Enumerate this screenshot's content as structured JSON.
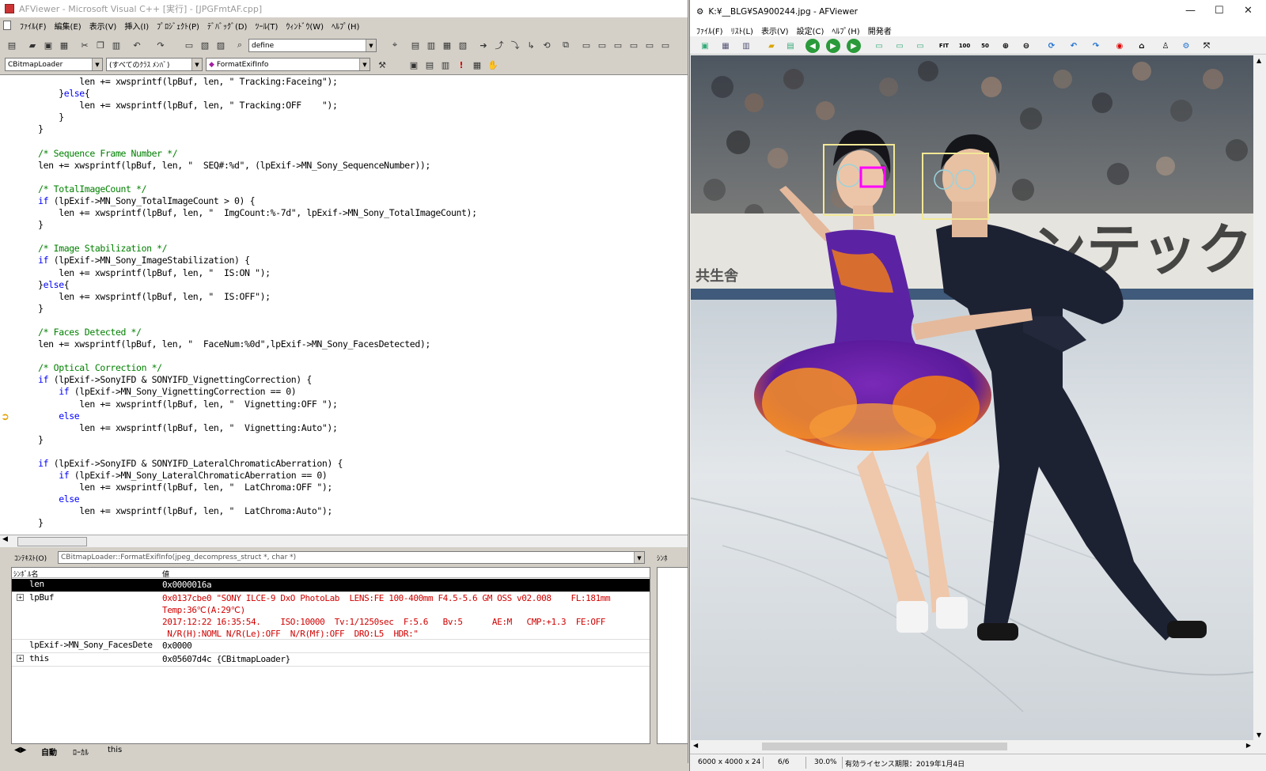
{
  "vs": {
    "title": "AFViewer - Microsoft Visual C++ [実行] - [JPGFmtAF.cpp]",
    "menu": [
      "ﾌｧｲﾙ(F)",
      "編集(E)",
      "表示(V)",
      "挿入(I)",
      "ﾌﾟﾛｼﾞｪｸﾄ(P)",
      "ﾃﾞﾊﾞｯｸﾞ(D)",
      "ﾂｰﾙ(T)",
      "ｳｨﾝﾄﾞｳ(W)",
      "ﾍﾙﾌﾟ(H)"
    ],
    "find_combo": "define",
    "class_combo": "CBitmapLoader",
    "member_combo": "(すべてのｸﾗｽ ﾒﾝﾊﾞ)",
    "function_combo": "FormatExifInfo",
    "code_lines": [
      "            len += xwsprintf(lpBuf, len, \" Tracking:Faceing\");",
      "        }else{",
      "            len += xwsprintf(lpBuf, len, \" Tracking:OFF    \");",
      "        }",
      "    }",
      "",
      "    /* Sequence Frame Number */",
      "    len += xwsprintf(lpBuf, len, \"  SEQ#:%d\", (lpExif->MN_Sony_SequenceNumber));",
      "",
      "    /* TotalImageCount */",
      "    if (lpExif->MN_Sony_TotalImageCount > 0) {",
      "        len += xwsprintf(lpBuf, len, \"  ImgCount:%-7d\", lpExif->MN_Sony_TotalImageCount);",
      "    }",
      "",
      "    /* Image Stabilization */",
      "    if (lpExif->MN_Sony_ImageStabilization) {",
      "        len += xwsprintf(lpBuf, len, \"  IS:ON \");",
      "    }else{",
      "        len += xwsprintf(lpBuf, len, \"  IS:OFF\");",
      "    }",
      "",
      "    /* Faces Detected */",
      "    len += xwsprintf(lpBuf, len, \"  FaceNum:%0d\",lpExif->MN_Sony_FacesDetected);",
      "",
      "    /* Optical Correction */",
      "    if (lpExif->SonyIFD & SONYIFD_VignettingCorrection) {",
      "        if (lpExif->MN_Sony_VignettingCorrection == 0)",
      "            len += xwsprintf(lpBuf, len, \"  Vignetting:OFF \");",
      "        else",
      "            len += xwsprintf(lpBuf, len, \"  Vignetting:Auto\");",
      "    }",
      "",
      "    if (lpExif->SonyIFD & SONYIFD_LateralChromaticAberration) {",
      "        if (lpExif->MN_Sony_LateralChromaticAberration == 0)",
      "            len += xwsprintf(lpBuf, len, \"  LatChroma:OFF \");",
      "        else",
      "            len += xwsprintf(lpBuf, len, \"  LatChroma:Auto\");",
      "    }"
    ],
    "context_label": "ｺﾝﾃｷｽﾄ(O)",
    "context_value": "CBitmapLoader::FormatExifInfo(jpeg_decompress_struct *, char *)",
    "watch_header": {
      "name": "ｼﾝﾎﾞﾙ名",
      "value": "値"
    },
    "watch_rows": [
      {
        "name": "len",
        "value": "0x0000016a"
      },
      {
        "name": "lpBuf",
        "value": "0x0137cbe0 \"SONY ILCE-9 DxO PhotoLab  LENS:FE 100-400mm F4.5-5.6 GM OSS v02.008    FL:181mm\nTemp:36℃(A:29℃)\n2017:12:22 16:35:54.    ISO:10000  Tv:1/1250sec  F:5.6   Bv:5      AE:M   CMP:+1.3  FE:OFF\n N/R(H):NOML N/R(Le):OFF  N/R(Mf):OFF  DRO:L5  HDR:\""
      },
      {
        "name": "lpExif->MN_Sony_FacesDete",
        "value": "0x0000"
      },
      {
        "name": "this",
        "value": "0x05607d4c {CBitmapLoader}"
      }
    ],
    "watch_tabs": [
      "自動",
      "ﾛｰｶﾙ",
      "this"
    ],
    "right_panel_label": "ｼﾝﾎ"
  },
  "af": {
    "title": "K:¥__BLG¥SA900244.jpg - AFViewer",
    "menu": [
      "ﾌｧｲﾙ(F)",
      "ﾘｽﾄ(L)",
      "表示(V)",
      "設定(C)",
      "ﾍﾙﾌﾟ(H)",
      "開発者"
    ],
    "status": {
      "dimensions": "6000 x 4000 x 24",
      "index": "6/6",
      "zoom": "30.0%",
      "license": "有効ライセンス期限：2019年1月4日"
    },
    "photo_text": {
      "banner": "ンテック",
      "sponsor": "共生舎"
    }
  },
  "colors": {
    "accent_blue": "#0000ff",
    "comment_green": "#008000",
    "value_red": "#d00000",
    "face_box": "#f2e896",
    "focus_box": "#ff00ff"
  }
}
